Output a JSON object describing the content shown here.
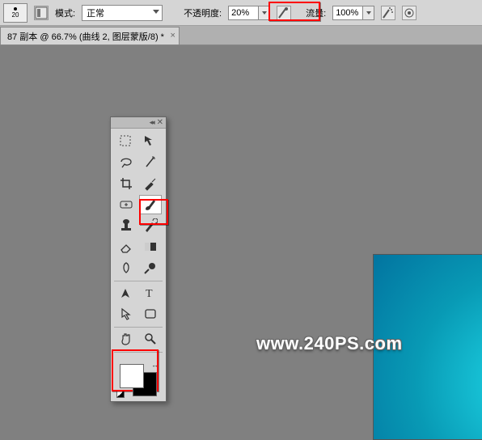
{
  "options": {
    "brush_size": "20",
    "mode_label": "模式:",
    "mode_value": "正常",
    "opacity_label": "不透明度:",
    "opacity_value": "20%",
    "flow_label": "流量:",
    "flow_value": "100%"
  },
  "tab": {
    "title": "87 副本 @ 66.7% (曲线 2, 图层蒙版/8) *"
  },
  "watermark": "www.240PS.com",
  "colors": {
    "foreground": "#ffffff",
    "background": "#000000"
  },
  "panel": {
    "collapse": "◂◂",
    "close": "✕"
  },
  "tools": {
    "marquee": "选框",
    "move": "移动",
    "lasso": "套索",
    "wand": "魔棒",
    "crop": "裁剪",
    "eyedrop": "吸管",
    "heal": "修复",
    "brush": "画笔",
    "stamp": "图章",
    "history": "历史画笔",
    "eraser": "橡皮",
    "fill": "填充",
    "smudge": "涂抹",
    "dodge": "减淡",
    "pen": "钢笔",
    "text": "文字",
    "path": "路径选择",
    "shape": "形状",
    "hand": "抓手",
    "zoom": "缩放"
  }
}
